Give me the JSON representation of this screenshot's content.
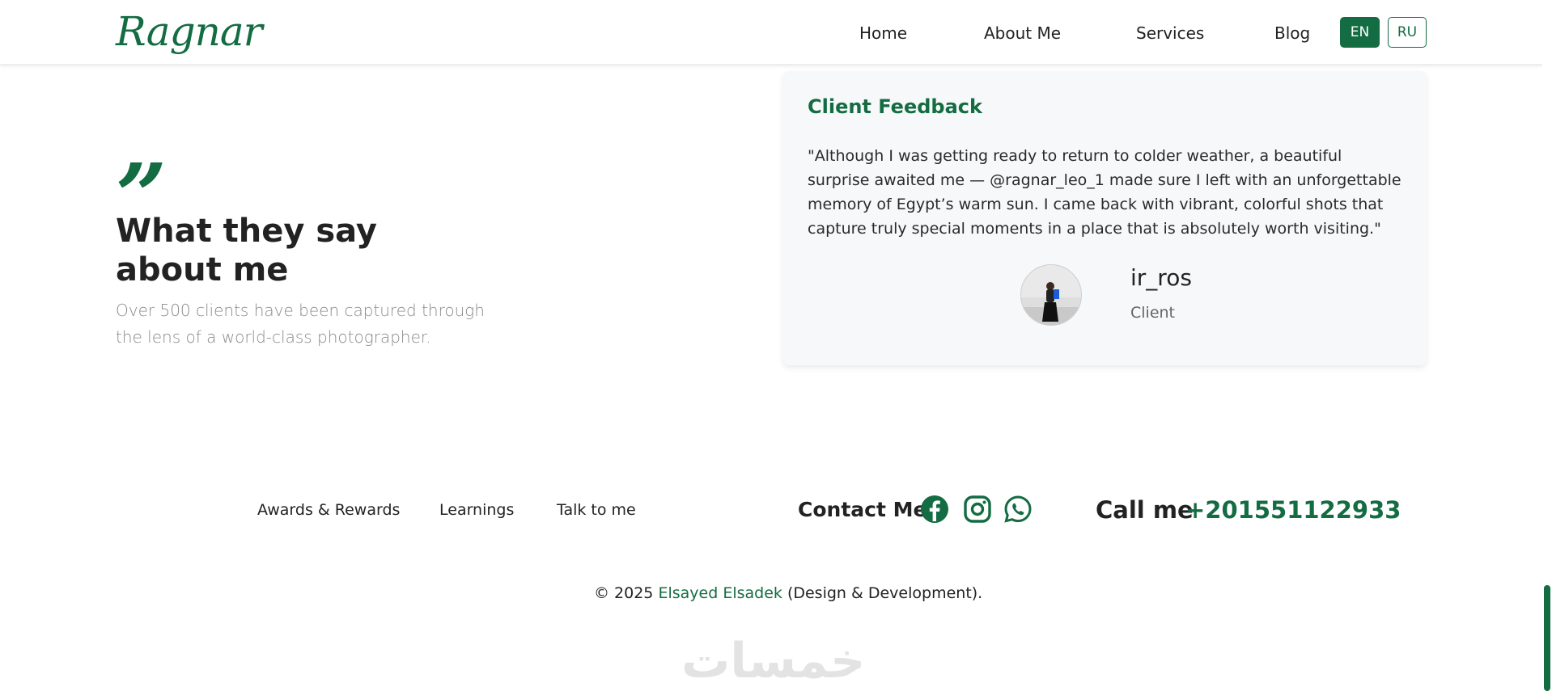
{
  "navbar": {
    "logo": "Ragnar",
    "links": [
      "Home",
      "About Me",
      "Services",
      "Blog"
    ],
    "lang_en": "EN",
    "lang_ru": "RU"
  },
  "testimonials": {
    "quote_mark": "”",
    "heading": "What they say about me",
    "subtitle": "Over 500 clients have been captured through the lens of a world-class photographer.",
    "card": {
      "title": "Client Feedback",
      "text": "\"Although I was getting ready to return to colder weather, a beautiful surprise awaited me — @ragnar_leo_1 made sure I left with an unforgettable memory of Egypt’s warm sun. I came back with vibrant, colorful shots that capture truly special moments in a place that is absolutely worth visiting.\"",
      "client_name": "ir_ros",
      "client_role": "Client"
    }
  },
  "footer": {
    "links": [
      "Awards & Rewards",
      "Learnings",
      "Talk to me"
    ],
    "contact_label": "Contact Me",
    "social_icons": [
      "facebook-icon",
      "instagram-icon",
      "whatsapp-icon"
    ],
    "call_label": "Call me",
    "call_number": "+201551122933",
    "copyright_prefix": "© 2025",
    "copyright_author": "Elsayed Elsadek",
    "copyright_suffix": "(Design & Development).",
    "watermark": "خمسات"
  },
  "colors": {
    "accent": "#146c43",
    "text": "#222222",
    "muted": "#8a8a8a",
    "card_bg": "#f7f8f9"
  }
}
